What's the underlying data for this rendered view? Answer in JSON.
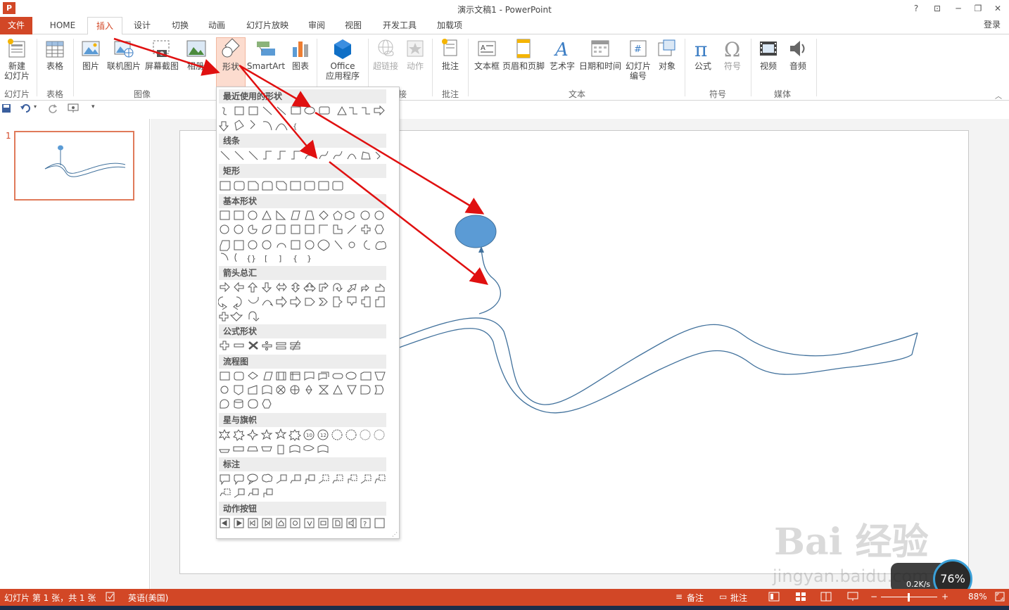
{
  "window": {
    "title": "演示文稿1 - PowerPoint",
    "app_icon": "P",
    "controls": [
      "?",
      "⊡",
      "─",
      "❐",
      "✕"
    ]
  },
  "tabs": {
    "file": "文件",
    "items": [
      "HOME",
      "插入",
      "设计",
      "切换",
      "动画",
      "幻灯片放映",
      "审阅",
      "视图",
      "开发工具",
      "加载项"
    ],
    "active": "插入",
    "login": "登录"
  },
  "ribbon": {
    "buttons": {
      "new_slide": "新建\n幻灯片",
      "table": "表格",
      "picture": "图片",
      "online_picture": "联机图片",
      "screenshot": "屏幕截图",
      "album": "相册",
      "shapes": "形状",
      "smartart": "SmartArt",
      "chart": "图表",
      "office_apps": "Office\n应用程序",
      "hyperlink": "超链接",
      "action": "动作",
      "comment": "批注",
      "textbox": "文本框",
      "header_footer": "页眉和页脚",
      "wordart": "艺术字",
      "datetime": "日期和时间",
      "slide_number": "幻灯片\n编号",
      "object": "对象",
      "equation": "公式",
      "symbol": "符号",
      "video": "视频",
      "audio": "音频"
    },
    "groups": {
      "slides": "幻灯片",
      "tables": "表格",
      "images": "图像",
      "links": "接",
      "comments": "批注",
      "text": "文本",
      "symbols": "符号",
      "media": "媒体"
    }
  },
  "shapes_menu": {
    "sections": [
      "最近使用的形状",
      "线条",
      "矩形",
      "基本形状",
      "箭头总汇",
      "公式形状",
      "流程图",
      "星与旗帜",
      "标注",
      "动作按钮"
    ]
  },
  "slide_panel": {
    "slide_number": "1"
  },
  "status": {
    "slide_info": "幻灯片 第 1 张，共 1 张",
    "language": "英语(美国)",
    "notes": "备注",
    "comments": "批注",
    "zoom": "88%"
  },
  "watermark": {
    "text": "Bai 经验",
    "url": "jingyan.baidu.com"
  },
  "net_widget": {
    "percent": "76%",
    "speed": "0.2K/s"
  },
  "colors": {
    "accent": "#d24726",
    "shape_fill": "#5b9bd5",
    "arrow": "#e01010",
    "line": "#41719c"
  }
}
